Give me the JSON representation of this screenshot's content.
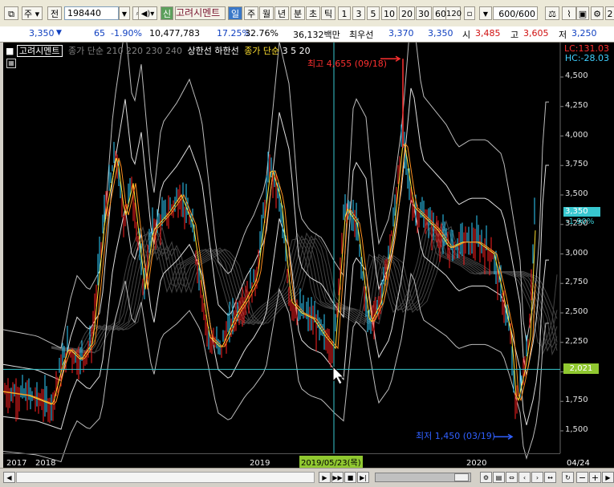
{
  "toolbar": {
    "type_label": "주",
    "range_label": "전",
    "code": "198440",
    "credit_badge": "신",
    "stock_name": "고려시멘트",
    "periods": [
      "일",
      "주",
      "월",
      "년",
      "분",
      "초",
      "틱"
    ],
    "intervals": [
      "1",
      "3",
      "5",
      "10",
      "20",
      "30",
      "60",
      "120"
    ],
    "count_value": "600",
    "count_total": "/600",
    "right_label": "2"
  },
  "quote": {
    "price": "3,350",
    "change": "65",
    "change_pct": "-1.90%",
    "volume": "10,477,783",
    "turnover_pct": "17.25%",
    "ratio_pct": "32.76%",
    "amount": "36,132백만",
    "ask_label": "최우선",
    "ask": "3,370",
    "bid": "3,350",
    "open_label": "시",
    "open": "3,485",
    "high_label": "고",
    "high": "3,605",
    "low_label": "저",
    "low": "3,250"
  },
  "legend": {
    "name": "고려시멘트",
    "ma_long": "종가 단순 210 220 230 240",
    "env": "상한선 하한선",
    "ma_short_label": "종가 단순",
    "ma_short": "3 5 20"
  },
  "corner": {
    "lc": "LC:131.03",
    "hc": "HC:-28.03"
  },
  "annotations": {
    "high_label": "최고 4,655 (09/18)",
    "low_label": "최저 1,450 (03/19)",
    "cursor_date": "2019/05/23(목)",
    "cursor_price": "2,021",
    "last_price": "3,350",
    "last_change": "-1.90%",
    "last_date": "04/24"
  },
  "y_axis": [
    "4,500",
    "4,250",
    "4,000",
    "3,750",
    "3,500",
    "3,250",
    "3,000",
    "2,750",
    "2,500",
    "2,250",
    "2,000",
    "1,750",
    "1,500"
  ],
  "x_axis": [
    "2017",
    "2018",
    "2019",
    "2020"
  ],
  "colors": {
    "up": "#ff2020",
    "down": "#30d0ff",
    "ma3": "#ffe030",
    "ma5": "#ff9020",
    "price_badge": "#38c8d0",
    "cursor_badge": "#90c830"
  }
}
